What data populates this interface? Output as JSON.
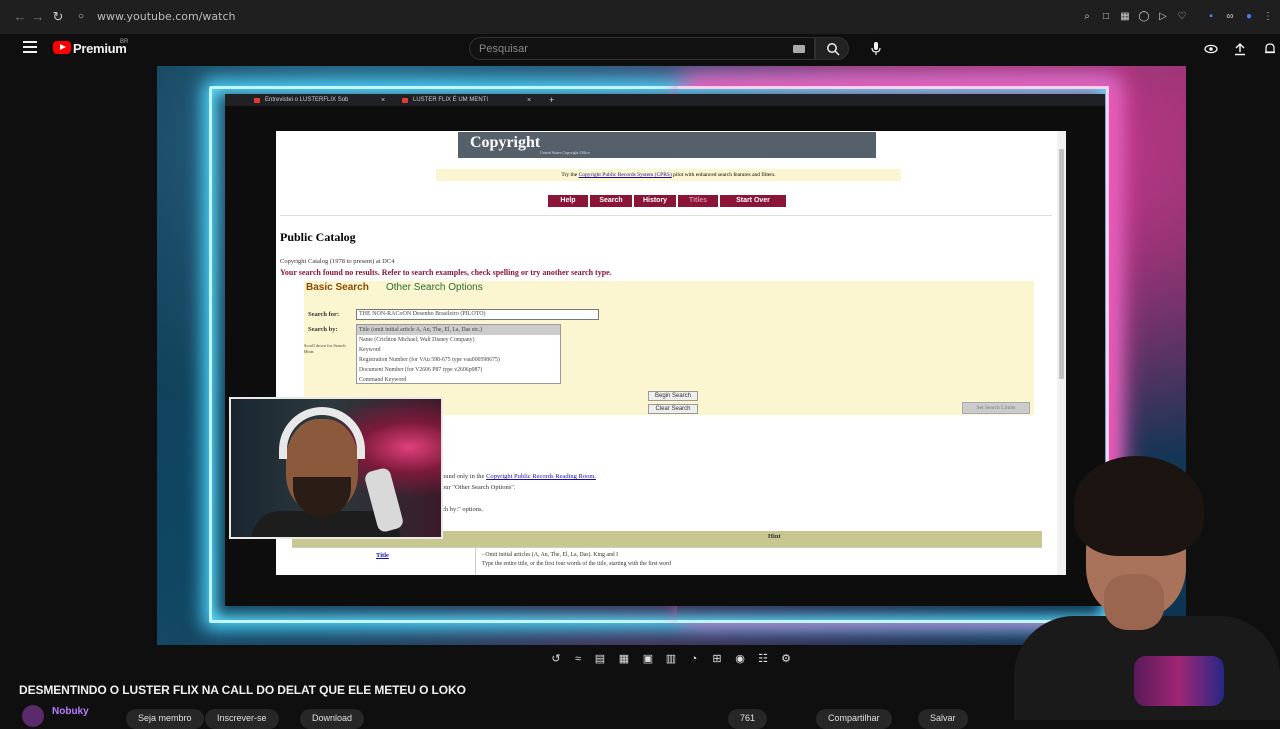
{
  "browser": {
    "url": "www.youtube.com/watch"
  },
  "masthead": {
    "brand": "Premium",
    "region": "BR",
    "search_placeholder": "Pesquisar"
  },
  "video_frame": {
    "tabs": [
      {
        "label": "Entrevistei o LUSTERFLIX Sob"
      },
      {
        "label": "LUSTER FLIX É UM MENTI"
      }
    ],
    "tab_close": "×",
    "new_tab": "+",
    "webpage": {
      "banner_logo": "Copyright",
      "banner_sub": "United States Copyright Office",
      "promo_prefix": "Try the",
      "promo_link": "Copyright Public Records System (CPRS)",
      "promo_suffix": "pilot with enhanced search features and filters.",
      "nav": [
        "Help",
        "Search",
        "History",
        "Titles",
        "Start Over"
      ],
      "page_title": "Public Catalog",
      "catalog_line": "Copyright Catalog (1978 to present) at DC4",
      "no_results": "Your search found no results. Refer to search examples, check spelling or try another search type.",
      "basic_search": "Basic Search",
      "other_search": "Other Search Options",
      "search_for_label": "Search for:",
      "search_for_value": "THE NON-RACoON Desenho Brasileiro (PILOTO)",
      "search_by_label": "Search by:",
      "scroll_hint": "Scroll down for Search Hints",
      "search_by_options": [
        "Title (omit initial article A, An, The, El, La, Das etc.)",
        "Name (Crichton Michael; Walt Disney Company)",
        "Keyword",
        "Registration Number (for VAu 598-675 type vau000598675)",
        "Document Number (for V2606 P87 type v2606p087)",
        "Command Keyword"
      ],
      "begin_search": "Begin Search",
      "clear_search": "Clear Search",
      "set_limits": "Set Search Limits",
      "note1_prefix": "ound only in the",
      "note1_link": "Copyright Public Records Reading Room.",
      "note2": "our \"Other Search Options\".",
      "note3": "ch by:\" options.",
      "table_hint_header": "Hint",
      "table_row_title": "Title",
      "table_row_hint1": "- Omit initial articles (A, An, The, El, La, Das). King and I",
      "table_row_hint2": "Type the entire title, or the first four words of the title, starting with the first word"
    }
  },
  "video": {
    "title": "DESMENTINDO O LUSTER FLIX NA CALL DO DELAT QUE ELE METEU O LOKO",
    "channel": "Nobuky",
    "actions": [
      "Seja membro",
      "Inscrever-se",
      "Download",
      "761",
      "Compartilhar",
      "Salvar"
    ]
  },
  "icons": {
    "back": "arrow-left-icon",
    "forward": "arrow-right-icon",
    "reload": "reload-icon",
    "lock": "lock-icon",
    "menu": "hamburger-icon",
    "search": "search-icon",
    "mic": "mic-icon",
    "cast": "cast-icon",
    "upload": "upload-icon",
    "bell": "bell-icon"
  },
  "colors": {
    "yt_red": "#ff0000",
    "copyright_maroon": "#8a1538",
    "accent_glow": "#4fd8ff"
  }
}
